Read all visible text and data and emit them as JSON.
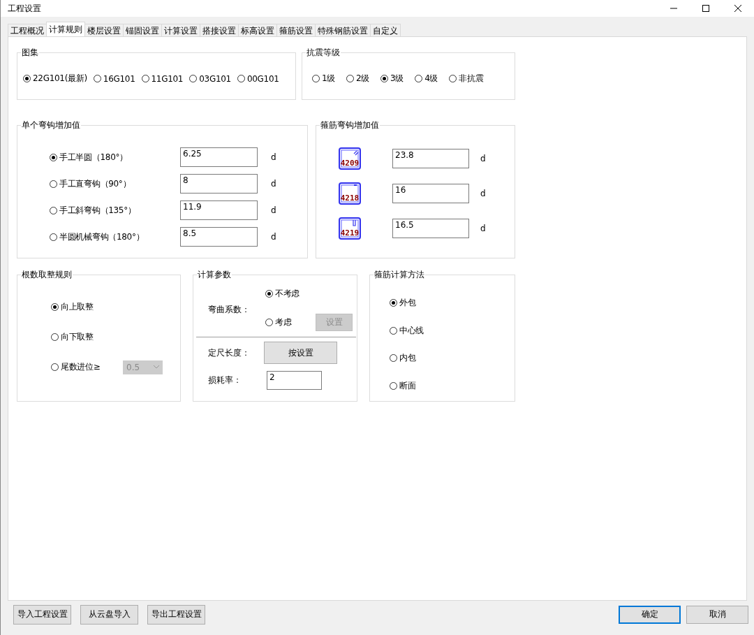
{
  "window": {
    "title": "工程设置"
  },
  "tabs": [
    {
      "label": "工程概况",
      "selected": false
    },
    {
      "label": "计算规则",
      "selected": true
    },
    {
      "label": "楼层设置",
      "selected": false
    },
    {
      "label": "锚固设置",
      "selected": false
    },
    {
      "label": "计算设置",
      "selected": false
    },
    {
      "label": "搭接设置",
      "selected": false
    },
    {
      "label": "标高设置",
      "selected": false
    },
    {
      "label": "箍筋设置",
      "selected": false
    },
    {
      "label": "特殊钢筋设置",
      "selected": false
    },
    {
      "label": "自定义",
      "selected": false
    }
  ],
  "atlas": {
    "title": "图集",
    "options": [
      {
        "label": "22G101(最新)",
        "selected": true
      },
      {
        "label": "16G101",
        "selected": false
      },
      {
        "label": "11G101",
        "selected": false
      },
      {
        "label": "03G101",
        "selected": false
      },
      {
        "label": "00G101",
        "selected": false
      }
    ]
  },
  "seismic_grade": {
    "title": "抗震等级",
    "options": [
      {
        "label": "1级",
        "selected": false
      },
      {
        "label": "2级",
        "selected": false
      },
      {
        "label": "3级",
        "selected": true
      },
      {
        "label": "4级",
        "selected": false
      },
      {
        "label": "非抗震",
        "selected": false
      }
    ]
  },
  "single_hook": {
    "title": "单个弯钩增加值",
    "rows": [
      {
        "label": "手工半圆（180°）",
        "selected": true,
        "value": "6.25",
        "unit": "d"
      },
      {
        "label": "手工直弯钩（90°）",
        "selected": false,
        "value": "8",
        "unit": "d"
      },
      {
        "label": "手工斜弯钩（135°）",
        "selected": false,
        "value": "11.9",
        "unit": "d"
      },
      {
        "label": "半圆机械弯钩（180°）",
        "selected": false,
        "value": "8.5",
        "unit": "d"
      }
    ]
  },
  "stirrup_hook": {
    "title": "箍筋弯钩增加值",
    "rows": [
      {
        "code": "4209",
        "value": "23.8",
        "unit": "d"
      },
      {
        "code": "4218",
        "value": "16",
        "unit": "d"
      },
      {
        "code": "4219",
        "value": "16.5",
        "unit": "d"
      }
    ]
  },
  "rounding": {
    "title": "根数取整规则",
    "options": [
      {
        "label": "向上取整",
        "selected": true
      },
      {
        "label": "向下取整",
        "selected": false
      },
      {
        "label": "尾数进位≥",
        "selected": false,
        "dropdown": {
          "value": "0.5",
          "disabled": true
        }
      }
    ]
  },
  "calc_params": {
    "title": "计算参数",
    "bend_label": "弯曲系数：",
    "bend_options": [
      {
        "label": "不考虑",
        "selected": true
      },
      {
        "label": "考虑",
        "selected": false
      }
    ],
    "bend_button": {
      "label": "设置",
      "disabled": true
    },
    "length_label": "定尺长度：",
    "length_button": {
      "label": "按设置",
      "disabled": false
    },
    "loss_label": "损耗率：",
    "loss_value": "2"
  },
  "stirrup_method": {
    "title": "箍筋计算方法",
    "options": [
      {
        "label": "外包",
        "selected": true
      },
      {
        "label": "中心线",
        "selected": false
      },
      {
        "label": "内包",
        "selected": false
      },
      {
        "label": "断面",
        "selected": false
      }
    ]
  },
  "footer": {
    "left_buttons": [
      "导入工程设置",
      "从云盘导入",
      "导出工程设置"
    ],
    "right_buttons": [
      {
        "label": "确定",
        "default": true
      },
      {
        "label": "取消",
        "default": false
      }
    ]
  }
}
